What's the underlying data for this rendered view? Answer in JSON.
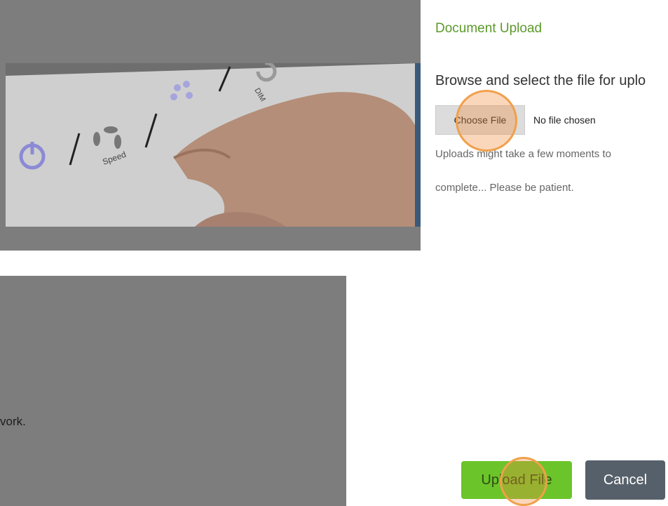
{
  "background": {
    "overlay_text": "vork."
  },
  "modal": {
    "title": "Document Upload",
    "instruction": "Browse and select the file for uplo",
    "file_input": {
      "button_label": "Choose File",
      "status": "No file chosen"
    },
    "hint_line1": "Uploads might take a few moments to",
    "hint_line2": "complete... Please be patient.",
    "buttons": {
      "upload": "Upload File",
      "cancel": "Cancel"
    }
  },
  "colors": {
    "title_green": "#5b9a2a",
    "upload_green": "#6bc52a",
    "cancel_gray": "#56606a",
    "click_marker": "#f0a04b"
  }
}
